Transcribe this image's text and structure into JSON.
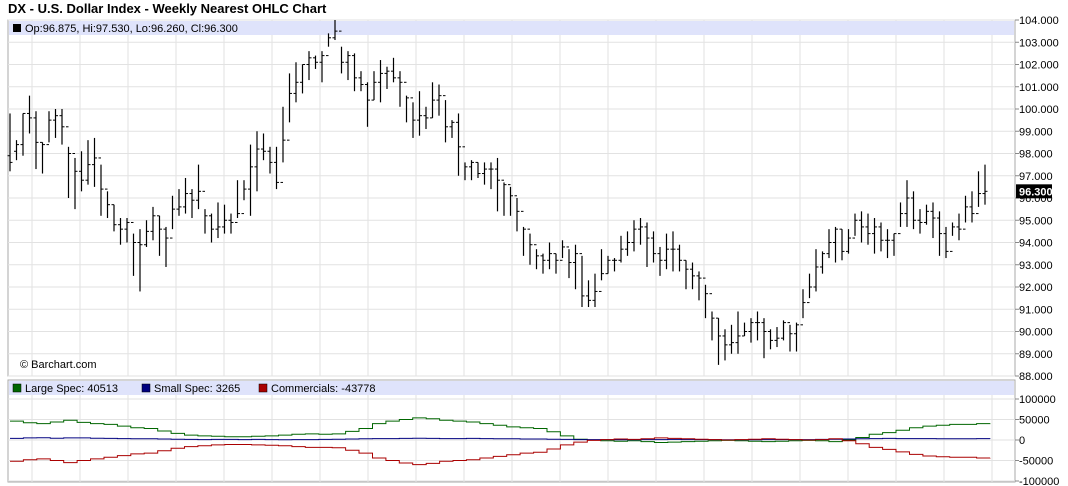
{
  "chart_data": [
    {
      "type": "ohlc",
      "title": "DX - U.S. Dollar Index - Weekly Nearest OHLC Chart",
      "info": {
        "text": "Op:96.875, Hi:97.530, Lo:96.260, Cl:96.300",
        "marker_color": "#000000"
      },
      "last_value_label": "96.300",
      "watermark": "© Barchart.com",
      "ylim": [
        88,
        104
      ],
      "y_ticks": [
        {
          "value": 104,
          "label": "104.000"
        },
        {
          "value": 103,
          "label": "103.000"
        },
        {
          "value": 102,
          "label": "102.000"
        },
        {
          "value": 101,
          "label": "101.000"
        },
        {
          "value": 100,
          "label": "100.000"
        },
        {
          "value": 99,
          "label": "99.000"
        },
        {
          "value": 98,
          "label": "98.000"
        },
        {
          "value": 97,
          "label": "97.000"
        },
        {
          "value": 96,
          "label": "96.000"
        },
        {
          "value": 95,
          "label": "95.000"
        },
        {
          "value": 94,
          "label": "94.000"
        },
        {
          "value": 93,
          "label": "93.000"
        },
        {
          "value": 92,
          "label": "92.000"
        },
        {
          "value": 91,
          "label": "91.000"
        },
        {
          "value": 90,
          "label": "90.000"
        },
        {
          "value": 89,
          "label": "89.000"
        },
        {
          "value": 88,
          "label": "88.000"
        }
      ],
      "grid": true,
      "bar_color": "#000000",
      "close": [
        97.6,
        98.4,
        99.8,
        99.6,
        98.5,
        98.4,
        99.5,
        99.7,
        99.2,
        98,
        97.2,
        96.8,
        97.5,
        97.8,
        96.4,
        95.7,
        94.8,
        94.6,
        94.9,
        94,
        93.9,
        94.5,
        95.2,
        94.6,
        94.2,
        95.5,
        95.6,
        96.2,
        95.9,
        96.3,
        95.2,
        94.6,
        94.7,
        95,
        94.9,
        95.3,
        96.4,
        97.4,
        98.2,
        98.1,
        97.6,
        96.7,
        98.6,
        100.7,
        101.2,
        102,
        102.3,
        102.1,
        102.4,
        103.2,
        103.5,
        102.1,
        102.4,
        101.4,
        101.1,
        100.4,
        101.2,
        101.6,
        101.7,
        101.4,
        101.2,
        100.5,
        99.5,
        99.7,
        99.6,
        100.4,
        100.6,
        99.2,
        99.4,
        98.3,
        97.4,
        97.6,
        97.1,
        97.3,
        97.3,
        96.8,
        96.6,
        96.1,
        95.4,
        94.6,
        93.9,
        93.4,
        93.2,
        93.5,
        93.2,
        93.8,
        93.1,
        93.5,
        91.6,
        91.4,
        91.8,
        92.6,
        93.2,
        93.2,
        93.7,
        94,
        94.6,
        94.7,
        94.2,
        93.5,
        93.2,
        93.7,
        93.7,
        93.2,
        92.8,
        92.5,
        92.4,
        91.7,
        90.6,
        89.8,
        89.4,
        89.5,
        89.8,
        90,
        90.4,
        90.4,
        90,
        89.6,
        89.7,
        90.4,
        89.9,
        90.3,
        91.3,
        92,
        92.9,
        93.5,
        94,
        94.6,
        93.6,
        94.2,
        95,
        94.7,
        94.4,
        94.7,
        94.1,
        94.1,
        94.4,
        95.3,
        96,
        95,
        94.9,
        95.4,
        95.1,
        94.4,
        93.6,
        94.7,
        94.6,
        95.6,
        95.3,
        96.2,
        96.3
      ],
      "high": [
        99.8,
        98.6,
        99.8,
        100.6,
        99.9,
        98.5,
        99.9,
        100,
        100,
        98.3,
        97.8,
        98.1,
        98.6,
        98.7,
        97.5,
        96.3,
        95.7,
        95.1,
        95.1,
        94.4,
        94.6,
        95,
        95.6,
        95.2,
        94.7,
        96.1,
        96.4,
        96.9,
        96.4,
        97.5,
        95.5,
        95.3,
        95.8,
        95.7,
        95.3,
        96.8,
        96.8,
        98.4,
        99,
        98.9,
        98.3,
        98.3,
        100.1,
        101.6,
        102.1,
        102,
        102.6,
        102.4,
        102.6,
        103.4,
        104,
        102.8,
        102.6,
        102.5,
        101.7,
        101.2,
        101.7,
        102.2,
        101.9,
        102.3,
        101.7,
        100.6,
        100.3,
        100.8,
        100.1,
        101.2,
        101.1,
        100.4,
        99.5,
        99.8,
        97.6,
        97.7,
        97.6,
        97.6,
        97.6,
        97.8,
        96.7,
        96.5,
        96,
        94.7,
        94.4,
        93.7,
        93.5,
        94,
        93.5,
        94.1,
        93.7,
        93.9,
        93.4,
        92.3,
        92.6,
        93.7,
        93.4,
        93.3,
        94.3,
        94.5,
        95,
        95.1,
        94.9,
        94.5,
        93.8,
        94.4,
        94.5,
        93.9,
        93.2,
        93.1,
        92.7,
        92.1,
        90.9,
        90.6,
        90.1,
        90.3,
        90.9,
        90.4,
        90.6,
        90.9,
        90.6,
        90.1,
        90.2,
        90.5,
        90.3,
        90.4,
        91.9,
        92.6,
        93.7,
        93.6,
        94.6,
        94.7,
        94.6,
        94.6,
        95.3,
        95.4,
        95.3,
        95.1,
        94.9,
        94.6,
        94.4,
        95.8,
        96.8,
        96.3,
        95.5,
        95.7,
        95.8,
        95.4,
        94.7,
        94.9,
        95.3,
        96.1,
        96.3,
        97.2,
        97.5
      ],
      "low": [
        97.2,
        97.7,
        97.9,
        98.9,
        97.3,
        97.1,
        98.5,
        98.7,
        98.4,
        96,
        95.5,
        96.3,
        96.6,
        96.5,
        95.2,
        95.1,
        94.5,
        93.9,
        94,
        92.5,
        91.8,
        93.8,
        94.1,
        93.4,
        92.9,
        94.6,
        95.2,
        95.3,
        95.1,
        95.5,
        94.4,
        94,
        94.2,
        94.4,
        94.4,
        95.1,
        95.9,
        95.2,
        96.3,
        97.7,
        97.1,
        96.4,
        97.6,
        99.4,
        100.3,
        100.7,
        101.3,
        101.8,
        101.2,
        102.8,
        103.1,
        101.6,
        101.3,
        100.8,
        100.8,
        99.2,
        100.4,
        100.3,
        100.9,
        101.2,
        100.1,
        99.4,
        98.7,
        98.8,
        99.1,
        99.6,
        99.7,
        98.5,
        98.7,
        97,
        96.8,
        96.8,
        96.9,
        96.6,
        96.4,
        95.4,
        95.2,
        95.2,
        94.5,
        93.4,
        93,
        92.8,
        92.6,
        92.8,
        92.6,
        93.3,
        92.4,
        91.9,
        91.1,
        91.1,
        91.1,
        92.3,
        92.6,
        92.7,
        93.1,
        93.4,
        93.6,
        93.9,
        92.9,
        93.1,
        92.5,
        92.8,
        92.7,
        92.7,
        91.9,
        91.9,
        91.4,
        90.6,
        89.6,
        88.5,
        88.7,
        89,
        89,
        89.8,
        89.5,
        89.6,
        88.8,
        89.2,
        89.3,
        89.6,
        89.1,
        89.1,
        90.6,
        91.5,
        91.8,
        92.6,
        93.3,
        93.1,
        93.2,
        93.5,
        94.3,
        94,
        93.9,
        93.5,
        93.6,
        93.3,
        93.4,
        94.7,
        94.7,
        94.6,
        94.4,
        94.8,
        94.2,
        93.4,
        93.3,
        94.3,
        94.1,
        94.9,
        94.9,
        95.6,
        95.7
      ],
      "open": [
        97.9,
        98.1,
        98.4,
        99.8,
        99.6,
        98.5,
        98.4,
        99.5,
        99.7,
        99.2,
        98,
        97.2,
        96.8,
        97.5,
        97.8,
        96.4,
        95.7,
        94.8,
        94.6,
        94.9,
        94,
        93.9,
        94.5,
        95.2,
        94.6,
        94.2,
        95.5,
        95.6,
        96.2,
        95.9,
        96.3,
        95.2,
        94.6,
        94.7,
        95,
        94.9,
        95.3,
        96.4,
        97.4,
        98.2,
        98.1,
        97.6,
        96.7,
        98.6,
        100.7,
        101.2,
        102,
        102.3,
        102.1,
        102.4,
        103.2,
        103.5,
        102.1,
        102.4,
        101.4,
        101.1,
        100.4,
        101.2,
        101.6,
        101.7,
        101.4,
        101.2,
        100.5,
        99.5,
        99.7,
        99.6,
        100.4,
        100.6,
        99.2,
        99.4,
        98.3,
        97.4,
        97.6,
        97.1,
        97.3,
        97.3,
        96.8,
        96.6,
        96.1,
        95.4,
        94.6,
        93.9,
        93.4,
        93.2,
        93.5,
        93.2,
        93.8,
        93.1,
        93.5,
        91.6,
        91.4,
        91.8,
        92.6,
        93.2,
        93.2,
        93.7,
        94,
        94.6,
        94.7,
        94.2,
        93.5,
        93.2,
        93.7,
        93.7,
        93.2,
        92.8,
        92.5,
        92.4,
        91.7,
        90.6,
        89.8,
        89.4,
        89.5,
        89.8,
        90,
        90.4,
        90.4,
        90,
        89.6,
        89.7,
        90.4,
        89.9,
        90.3,
        91.3,
        92,
        92.9,
        93.5,
        94,
        94.6,
        93.6,
        94.2,
        95,
        94.7,
        94.4,
        94.7,
        94.1,
        94.1,
        94.4,
        95.3,
        96,
        95,
        94.9,
        95.4,
        95.1,
        94.4,
        93.6,
        94.7,
        94.6,
        95.6,
        95.3,
        96.2,
        96.9
      ]
    },
    {
      "type": "line",
      "ylim": [
        -100000,
        100000
      ],
      "y_ticks": [
        {
          "value": 100000,
          "label": "100000"
        },
        {
          "value": 50000,
          "label": "50000"
        },
        {
          "value": 0,
          "label": "0"
        },
        {
          "value": -50000,
          "label": "-50000"
        },
        {
          "value": -100000,
          "label": "-100000"
        }
      ],
      "grid": true,
      "legend": [
        {
          "text": "Large Spec: 40513",
          "color": "#006600"
        },
        {
          "text": "Small Spec: 3265",
          "color": "#000080"
        },
        {
          "text": "Commercials: -43778",
          "color": "#aa0000"
        }
      ],
      "series": [
        {
          "name": "Large Spec",
          "color": "#006600",
          "values": [
            46000,
            42000,
            40000,
            44000,
            48000,
            43000,
            40000,
            38000,
            34000,
            30000,
            28000,
            22000,
            16000,
            12000,
            10000,
            9000,
            8000,
            8000,
            9000,
            10000,
            12000,
            14000,
            15000,
            14000,
            15000,
            21000,
            28000,
            40000,
            46000,
            50000,
            54000,
            52000,
            48000,
            46000,
            44000,
            40000,
            36000,
            32000,
            30000,
            28000,
            20000,
            10000,
            2000,
            0,
            -2000,
            -3000,
            -2000,
            -4000,
            -6000,
            -5000,
            -4000,
            -3000,
            -2000,
            -1000,
            -2000,
            -3000,
            -4000,
            -3000,
            -2000,
            -1000,
            -2000,
            -4000,
            0,
            6000,
            14000,
            18000,
            24000,
            30000,
            34000,
            36000,
            38000,
            38000,
            40000,
            40513
          ]
        },
        {
          "name": "Small Spec",
          "color": "#000080",
          "values": [
            4000,
            5000,
            5500,
            4500,
            5000,
            5000,
            4500,
            4000,
            3500,
            3000,
            3000,
            2500,
            2000,
            1500,
            1000,
            1500,
            1500,
            1000,
            1500,
            1000,
            500,
            1000,
            1000,
            1500,
            2000,
            2500,
            3000,
            3500,
            3500,
            4000,
            4500,
            4000,
            3500,
            3500,
            4000,
            3500,
            3000,
            3000,
            2500,
            2500,
            2000,
            1500,
            1000,
            1000,
            1000,
            500,
            500,
            1000,
            1000,
            1500,
            1000,
            1000,
            1000,
            500,
            500,
            500,
            1000,
            1000,
            1000,
            1000,
            1500,
            2000,
            2500,
            3000,
            3500,
            4000,
            3500,
            3500,
            3500,
            3000,
            3000,
            3000,
            3500,
            3265
          ]
        },
        {
          "name": "Commercials",
          "color": "#aa0000",
          "values": [
            -52000,
            -48000,
            -46000,
            -50000,
            -55000,
            -50000,
            -46000,
            -42000,
            -38000,
            -34000,
            -32000,
            -26000,
            -20000,
            -16000,
            -14000,
            -12000,
            -11000,
            -11000,
            -12000,
            -13000,
            -14000,
            -16000,
            -18000,
            -18000,
            -19000,
            -25000,
            -32000,
            -44000,
            -50000,
            -56000,
            -60000,
            -57000,
            -52000,
            -50000,
            -48000,
            -44000,
            -40000,
            -36000,
            -32000,
            -30000,
            -22000,
            -12000,
            -5000,
            -1000,
            1000,
            2500,
            1500,
            3000,
            5000,
            4000,
            3000,
            2000,
            1000,
            0,
            1000,
            2000,
            3000,
            2000,
            1000,
            0,
            1000,
            3000,
            -2000,
            -9000,
            -18000,
            -23000,
            -29000,
            -35000,
            -39000,
            -41000,
            -42000,
            -42000,
            -44000,
            -43778
          ]
        }
      ]
    }
  ]
}
